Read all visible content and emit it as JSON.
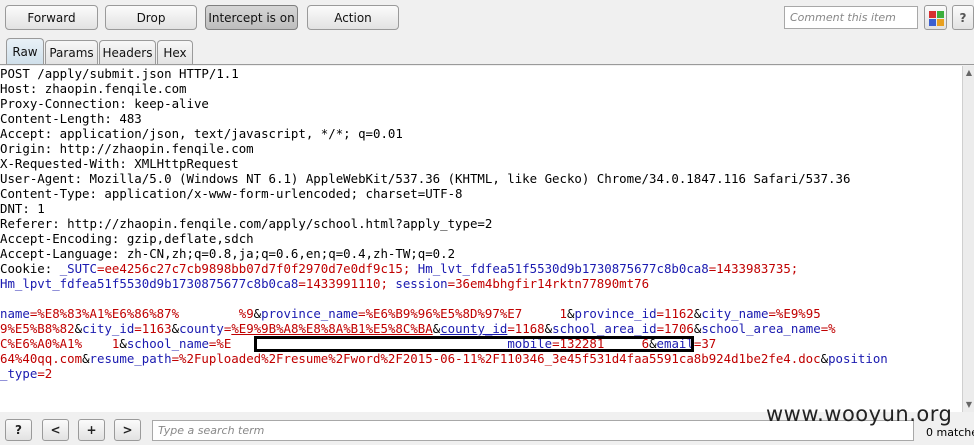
{
  "toolbar": {
    "forward_label": "Forward",
    "drop_label": "Drop",
    "intercept_label": "Intercept is on",
    "action_label": "Action",
    "comment_placeholder": "Comment this item",
    "help_label": "?",
    "highlight_colors": [
      "#d83030",
      "#3cae3c",
      "#3b5fd0",
      "#e8a020"
    ]
  },
  "tabs": [
    {
      "label": "Raw",
      "active": true
    },
    {
      "label": "Params",
      "active": false
    },
    {
      "label": "Headers",
      "active": false
    },
    {
      "label": "Hex",
      "active": false
    }
  ],
  "request": {
    "lines": [
      [
        {
          "t": "POST /apply/submit.json HTTP/1.1",
          "c": "k"
        }
      ],
      [
        {
          "t": "Host: zhaopin.fenqile.com",
          "c": "k"
        }
      ],
      [
        {
          "t": "Proxy-Connection: keep-alive",
          "c": "k"
        }
      ],
      [
        {
          "t": "Content-Length: 483",
          "c": "k"
        }
      ],
      [
        {
          "t": "Accept: application/json, text/javascript, */*; q=0.01",
          "c": "k"
        }
      ],
      [
        {
          "t": "Origin: http://zhaopin.fenqile.com",
          "c": "k"
        }
      ],
      [
        {
          "t": "X-Requested-With: XMLHttpRequest",
          "c": "k"
        }
      ],
      [
        {
          "t": "User-Agent: Mozilla/5.0 (Windows NT 6.1) AppleWebKit/537.36 (KHTML, like Gecko) Chrome/34.0.1847.116 Safari/537.36",
          "c": "k"
        }
      ],
      [
        {
          "t": "Content-Type: application/x-www-form-urlencoded; charset=UTF-8",
          "c": "k"
        }
      ],
      [
        {
          "t": "DNT: 1",
          "c": "k"
        }
      ],
      [
        {
          "t": "Referer: http://zhaopin.fenqile.com/apply/school.html?apply_type=2",
          "c": "k"
        }
      ],
      [
        {
          "t": "Accept-Encoding: gzip,deflate,sdch",
          "c": "k"
        }
      ],
      [
        {
          "t": "Accept-Language: zh-CN,zh;q=0.8,ja;q=0.6,en;q=0.4,zh-TW;q=0.2",
          "c": "k"
        }
      ],
      [
        {
          "t": "Cookie: ",
          "c": "k"
        },
        {
          "t": "_SUTC",
          "c": "b"
        },
        {
          "t": "=ee4256c27c7cb9898bb07d7f0f2970d7e0df9c15; ",
          "c": "r"
        },
        {
          "t": "Hm_lvt_fdfea51f5530d9b1730875677c8b0ca8",
          "c": "b"
        },
        {
          "t": "=1433983735;",
          "c": "r"
        }
      ],
      [
        {
          "t": "Hm_lpvt_fdfea51f5530d9b1730875677c8b0ca8",
          "c": "b"
        },
        {
          "t": "=1433991110; ",
          "c": "r"
        },
        {
          "t": "session",
          "c": "b"
        },
        {
          "t": "=36em4bhgfir14rktn77890mt76",
          "c": "r"
        }
      ],
      [
        {
          "t": "",
          "c": "k"
        }
      ],
      [
        {
          "t": "name",
          "c": "b"
        },
        {
          "t": "=%E8%83%A1%E6%86%87%",
          "c": "r"
        },
        {
          "t": "        ",
          "c": "k"
        },
        {
          "t": "%9",
          "c": "r"
        },
        {
          "t": "&",
          "c": "k"
        },
        {
          "t": "province_name",
          "c": "b"
        },
        {
          "t": "=%E6%B9%96%E5%8D%97%E7",
          "c": "r"
        },
        {
          "t": "     ",
          "c": "k"
        },
        {
          "t": "1",
          "c": "r"
        },
        {
          "t": "&",
          "c": "k"
        },
        {
          "t": "province_id",
          "c": "b"
        },
        {
          "t": "=1162",
          "c": "r"
        },
        {
          "t": "&",
          "c": "k"
        },
        {
          "t": "city_name",
          "c": "b"
        },
        {
          "t": "=%E9%95",
          "c": "r"
        }
      ],
      [
        {
          "t": "9%E5%B8%82",
          "c": "r"
        },
        {
          "t": "&",
          "c": "k"
        },
        {
          "t": "city_id",
          "c": "b"
        },
        {
          "t": "=1163",
          "c": "r"
        },
        {
          "t": "&",
          "c": "k"
        },
        {
          "t": "county",
          "c": "b"
        },
        {
          "t": "=",
          "c": "r"
        },
        {
          "t": "%E9%9B%A8%E8%8A%B1%E5%8C%BA",
          "c": "r u"
        },
        {
          "t": "&",
          "c": "k"
        },
        {
          "t": "county_id",
          "c": "b u"
        },
        {
          "t": "=1168",
          "c": "r"
        },
        {
          "t": "&",
          "c": "k"
        },
        {
          "t": "school_area_id",
          "c": "b"
        },
        {
          "t": "=1706",
          "c": "r"
        },
        {
          "t": "&",
          "c": "k"
        },
        {
          "t": "school_area_name",
          "c": "b"
        },
        {
          "t": "=%",
          "c": "r"
        }
      ],
      [
        {
          "t": "C%E6%A0%A1%",
          "c": "r"
        },
        {
          "t": "    ",
          "c": "k"
        },
        {
          "t": "1",
          "c": "r"
        },
        {
          "t": "&",
          "c": "k"
        },
        {
          "t": "school_name",
          "c": "b"
        },
        {
          "t": "=%E",
          "c": "r"
        },
        {
          "t": "                                     ",
          "c": "k"
        },
        {
          "t": "mobile",
          "c": "b"
        },
        {
          "t": "=132281",
          "c": "r"
        },
        {
          "t": "     ",
          "c": "k"
        },
        {
          "t": "6",
          "c": "r"
        },
        {
          "t": "&",
          "c": "k"
        },
        {
          "t": "email",
          "c": "b"
        },
        {
          "t": "=37",
          "c": "r"
        }
      ],
      [
        {
          "t": "64%40qq.com",
          "c": "r"
        },
        {
          "t": "&",
          "c": "k"
        },
        {
          "t": "resume_path",
          "c": "b"
        },
        {
          "t": "=%2Fuploaded%2Fresume%2Fword%2F2015-06-11%2F110346_3e45f531d4faa5591ca8b924d1be2fe4.doc",
          "c": "r"
        },
        {
          "t": "&",
          "c": "k"
        },
        {
          "t": "position",
          "c": "b"
        }
      ],
      [
        {
          "t": "_type",
          "c": "b"
        },
        {
          "t": "=2",
          "c": "r"
        }
      ]
    ]
  },
  "search": {
    "help_label": "?",
    "prev_label": "<",
    "add_label": "+",
    "next_label": ">",
    "placeholder": "Type a search term",
    "matches_text": "0 matches"
  },
  "watermark": "www.wooyun.org"
}
